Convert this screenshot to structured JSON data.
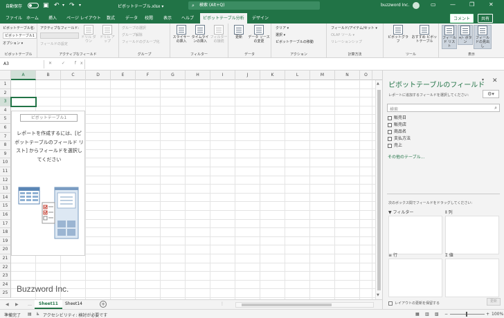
{
  "title_bar": {
    "autosave": "自動保存",
    "autosave_state": "オフ",
    "filename": "ピボットテーブル.xlsx ▾",
    "search_placeholder": "検索 (Alt+Q)",
    "user": "buzzword Inc."
  },
  "ribbon_tabs": [
    {
      "label": "ファイル"
    },
    {
      "label": "ホーム"
    },
    {
      "label": "挿入"
    },
    {
      "label": "ページ レイアウト"
    },
    {
      "label": "数式"
    },
    {
      "label": "データ"
    },
    {
      "label": "校閲"
    },
    {
      "label": "表示"
    },
    {
      "label": "ヘルプ"
    },
    {
      "label": "ピボットテーブル分析"
    },
    {
      "label": "デザイン"
    }
  ],
  "share": {
    "comment": "コメント",
    "share": "共有"
  },
  "ribbon": {
    "pivot_name_label": "ピボットテーブル名:",
    "pivot_name_value": "ピボットテーブル1",
    "options": "オプション ▾",
    "active_field_label": "アクティブなフィールド:",
    "field_settings": "フィールドの設定",
    "drill_down": "ドリル ダウン",
    "drill_up": "ドリル アップ",
    "group_selection": "グループの選択",
    "ungroup": "グループ解除",
    "group_field": "フィールドのグループ化",
    "slicer": "スライサーの挿入",
    "timeline": "タイムラインの挿入",
    "filter_conn": "フィルターの接続",
    "refresh": "更新",
    "change_source": "データ ソースの変更",
    "clear": "クリア ▾",
    "select": "選択 ▾",
    "move_pivot": "ピボットテーブルの移動",
    "fields_items": "フィールド/アイテム/セット ▾",
    "olap": "OLAP ツール ▾",
    "relationships": "リレーションシップ",
    "pivot_chart": "ピボットグラフ",
    "recommended": "おすすめ ピボットテーブル",
    "field_list": "フィールド リスト",
    "buttons": "+/- ボタン",
    "headers": "フィールドの見出し",
    "groups": {
      "pivottable": "ピボットテーブル",
      "active_field": "アクティブなフィールド",
      "group": "グループ",
      "filter": "フィルター",
      "data": "データ",
      "actions": "アクション",
      "calculations": "計算方法",
      "tools": "ツール",
      "show": "表示"
    }
  },
  "formula_bar": {
    "name_box": "A3",
    "fx": "✕ ✓ fx",
    "content": ""
  },
  "grid": {
    "columns": [
      "A",
      "B",
      "C",
      "D",
      "E",
      "F",
      "G",
      "H",
      "I",
      "J",
      "K",
      "L",
      "M",
      "N",
      "O"
    ],
    "rows": [
      "1",
      "2",
      "3",
      "4",
      "5",
      "6",
      "7",
      "8",
      "9",
      "10",
      "11",
      "12",
      "13",
      "14",
      "15",
      "16",
      "17",
      "18",
      "19",
      "20",
      "21",
      "22",
      "23",
      "24",
      "25"
    ]
  },
  "pivot_placeholder": {
    "title": "ピボットテーブル1",
    "desc": "レポートを作成するには、[ピボットテーブルのフィールド リスト] からフィールドを選択してください"
  },
  "watermark": "Buzzword Inc.",
  "sheets": [
    {
      "name": "Sheet11"
    },
    {
      "name": "Sheet14"
    }
  ],
  "status_bar": {
    "mode": "準備完了",
    "accessibility": "アクセシビリティ: 検討が必要です",
    "zoom": "100%"
  },
  "field_pane": {
    "title": "ピボットテーブルのフィールド",
    "hint": "レポートに追加するフィールドを選択してください:",
    "search_placeholder": "検索",
    "fields": [
      {
        "label": "販売日",
        "checked": false
      },
      {
        "label": "販売店",
        "checked": false
      },
      {
        "label": "商品名",
        "checked": false
      },
      {
        "label": "支払方法",
        "checked": false
      },
      {
        "label": "売上",
        "checked": false
      }
    ],
    "more_tables": "その他のテーブル...",
    "drag_hint": "次のボックス間でフィールドをドラッグしてください:",
    "areas": {
      "filter": "フィルター",
      "columns": "列",
      "rows": "行",
      "values": "値"
    },
    "defer": "レイアウトの更新を保留する",
    "update": "更新"
  }
}
